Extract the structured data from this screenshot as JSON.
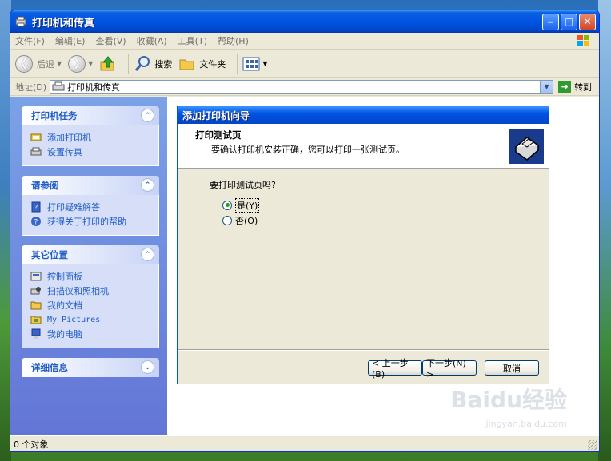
{
  "window": {
    "title": "打印机和传真"
  },
  "menu": [
    "文件(F)",
    "编辑(E)",
    "查看(V)",
    "收藏(A)",
    "工具(T)",
    "帮助(H)"
  ],
  "toolbar": {
    "back": "后退",
    "search": "搜索",
    "folders": "文件夹"
  },
  "address": {
    "label": "地址(D)",
    "value": "打印机和传真",
    "go": "转到"
  },
  "sidebar": {
    "tasks": {
      "title": "打印机任务",
      "items": [
        "添加打印机",
        "设置传真"
      ]
    },
    "see_also": {
      "title": "请参阅",
      "items": [
        "打印疑难解答",
        "获得关于打印的帮助"
      ]
    },
    "other_places": {
      "title": "其它位置",
      "items": [
        "控制面板",
        "扫描仪和照相机",
        "我的文档",
        "My Pictures",
        "我的电脑"
      ]
    },
    "details": {
      "title": "详细信息"
    }
  },
  "wizard": {
    "title": "添加打印机向导",
    "header": "打印测试页",
    "subheader": "要确认打印机安装正确，您可以打印一张测试页。",
    "question": "要打印测试页吗?",
    "options": [
      {
        "label": "是(Y)",
        "selected": true
      },
      {
        "label": "否(O)",
        "selected": false
      }
    ],
    "buttons": {
      "back": "< 上一步(B)",
      "next": "下一步(N) >",
      "cancel": "取消"
    }
  },
  "status": {
    "text": "0 个对象"
  },
  "watermark": {
    "brand": "Baidu经验",
    "url": "jingyan.baidu.com"
  }
}
